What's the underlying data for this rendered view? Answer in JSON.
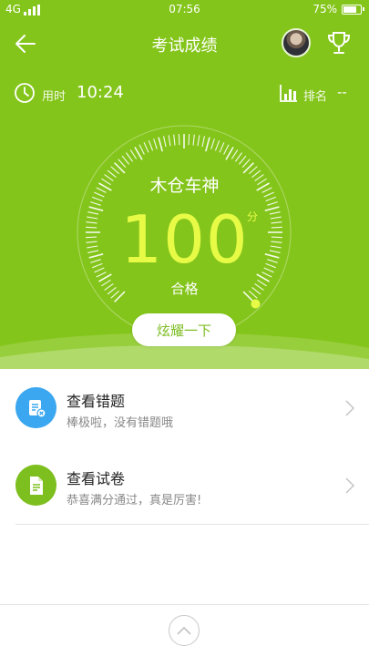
{
  "status_bar": {
    "signal": "4G",
    "time": "07:56",
    "battery": "75%",
    "battery_level": 0.75
  },
  "nav": {
    "title": "考试成绩",
    "back_icon": "arrow-left-icon",
    "trophy_icon": "trophy-icon"
  },
  "info": {
    "time_label": "用时",
    "time_value": "10:24",
    "rank_label": "排名",
    "rank_value": "--"
  },
  "score": {
    "name": "木仓车神",
    "value": "100",
    "unit": "分",
    "status": "合格",
    "progress": 1.0
  },
  "share_button": "炫耀一下",
  "list": [
    {
      "title": "查看错题",
      "desc": "棒极啦，没有错题哦",
      "icon": "wrong-question-icon",
      "color": "#3aa7f0"
    },
    {
      "title": "查看试卷",
      "desc": "恭喜满分通过，真是厉害!",
      "icon": "exam-paper-icon",
      "color": "#7dbf1e"
    }
  ],
  "colors": {
    "primary": "#84c51b",
    "score": "#e7fb46",
    "blue": "#3aa7f0"
  }
}
